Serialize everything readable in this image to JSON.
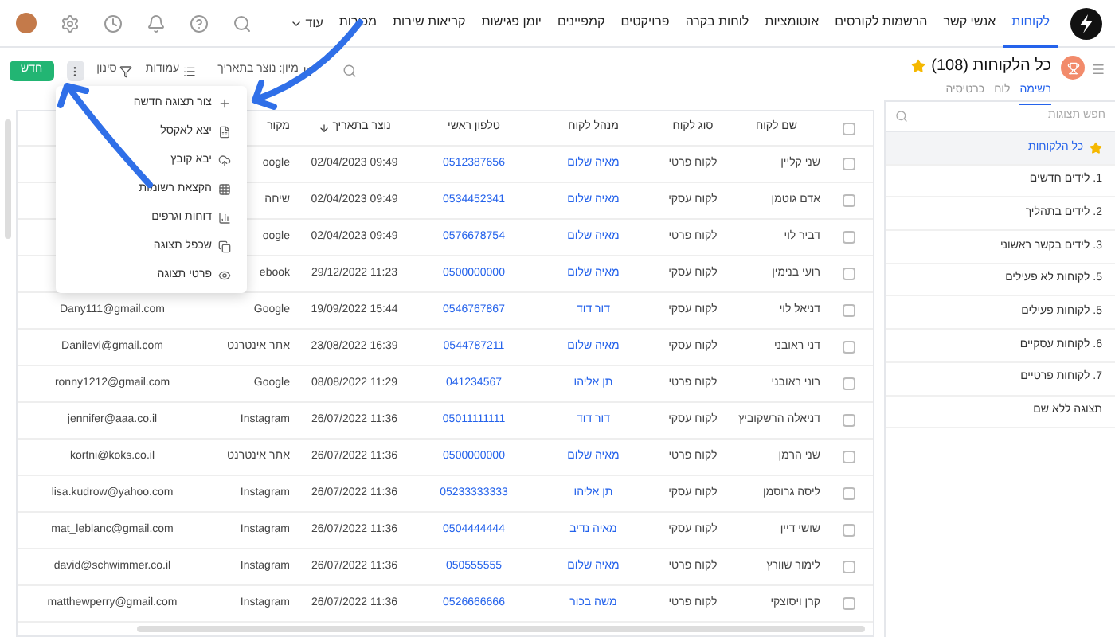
{
  "nav": {
    "items": [
      {
        "label": "לקוחות",
        "selected": true
      },
      {
        "label": "אנשי קשר",
        "selected": false
      },
      {
        "label": "הרשמות לקורסים",
        "selected": false
      },
      {
        "label": "אוטומציות",
        "selected": false
      },
      {
        "label": "לוחות בקרה",
        "selected": false
      },
      {
        "label": "פרויקטים",
        "selected": false
      },
      {
        "label": "קמפיינים",
        "selected": false
      },
      {
        "label": "יומן פגישות",
        "selected": false
      },
      {
        "label": "קריאות שירות",
        "selected": false
      },
      {
        "label": "מכירות",
        "selected": false
      }
    ],
    "more": "עוד"
  },
  "header": {
    "title": "כל הלקוחות (108)",
    "favorite": true,
    "tabs": [
      {
        "label": "רשימה",
        "selected": true
      },
      {
        "label": "לוח",
        "selected": false
      },
      {
        "label": "כרטיסיה",
        "selected": false
      }
    ],
    "toolbar": {
      "sort": "מיון: נוצר בתאריך",
      "columns": "עמודות",
      "filter": "סינון",
      "new": "חדש"
    }
  },
  "sidebar": {
    "placeholder": "חפש תצוגות",
    "items": [
      {
        "label": "כל הלקוחות",
        "selected": true
      },
      {
        "label": "1. לידים חדשים",
        "selected": false
      },
      {
        "label": "2. לידים בתהליך",
        "selected": false
      },
      {
        "label": "3. לידים בקשר ראשוני",
        "selected": false
      },
      {
        "label": "5. לקוחות לא פעילים",
        "selected": false
      },
      {
        "label": "5. לקוחות פעילים",
        "selected": false
      },
      {
        "label": "6. לקוחות עסקיים",
        "selected": false
      },
      {
        "label": "7. לקוחות פרטיים",
        "selected": false
      },
      {
        "label": "תצוגה ללא שם",
        "selected": false
      }
    ]
  },
  "table": {
    "all_checked": false,
    "columns": [
      {
        "label": "שם לקוח",
        "sorted": false
      },
      {
        "label": "סוג לקוח",
        "sorted": false
      },
      {
        "label": "מנהל לקוח",
        "sorted": false
      },
      {
        "label": "טלפון ראשי",
        "sorted": false
      },
      {
        "label": "נוצר בתאריך",
        "sorted": true
      },
      {
        "label": "מקור",
        "sorted": false
      }
    ],
    "rows": [
      {
        "checked": false,
        "cells": [
          "שני קליין",
          "לקוח פרטי",
          "מאיה שלום",
          "0512387656",
          "09:49 02/04/2023",
          "oogle"
        ]
      },
      {
        "checked": false,
        "cells": [
          "אדם גוטמן",
          "לקוח עסקי",
          "מאיה שלום",
          "0534452341",
          "09:49 02/04/2023",
          "שיחה"
        ]
      },
      {
        "checked": false,
        "cells": [
          "דביר לוי",
          "לקוח פרטי",
          "מאיה שלום",
          "0576678754",
          "09:49 02/04/2023",
          "oogle"
        ]
      },
      {
        "checked": false,
        "cells": [
          "רועי בנימין",
          "לקוח עסקי",
          "מאיה שלום",
          "0500000000",
          "11:23 29/12/2022",
          "ebook"
        ]
      },
      {
        "checked": false,
        "cells": [
          "דניאל לוי",
          "לקוח עסקי",
          "דור דוד",
          "0546767867",
          "15:44 19/09/2022",
          "Google",
          "Dany111@gmail.com"
        ]
      },
      {
        "checked": false,
        "cells": [
          "דני ראובני",
          "לקוח עסקי",
          "מאיה שלום",
          "0544787211",
          "16:39 23/08/2022",
          "אתר אינטרנט",
          "Danilevi@gmail.com"
        ]
      },
      {
        "checked": false,
        "cells": [
          "רוני ראובני",
          "לקוח פרטי",
          "תן אליהו",
          "041234567",
          "11:29 08/08/2022",
          "Google",
          "ronny1212@gmail.com"
        ]
      },
      {
        "checked": false,
        "cells": [
          "דניאלה הרשקוביץ",
          "לקוח עסקי",
          "דור דוד",
          "05011111111",
          "11:36 26/07/2022",
          "Instagram",
          "jennifer@aaa.co.il"
        ]
      },
      {
        "checked": false,
        "cells": [
          "שני הרמן",
          "לקוח פרטי",
          "מאיה שלום",
          "0500000000",
          "11:36 26/07/2022",
          "אתר אינטרנט",
          "kortni@koks.co.il"
        ]
      },
      {
        "checked": false,
        "cells": [
          "ליסה גרוסמן",
          "לקוח עסקי",
          "תן אליהו",
          "05233333333",
          "11:36 26/07/2022",
          "Instagram",
          "lisa.kudrow@yahoo.com"
        ]
      },
      {
        "checked": false,
        "cells": [
          "שושי דיין",
          "לקוח עסקי",
          "מאיה נדיב",
          "0504444444",
          "11:36 26/07/2022",
          "Instagram",
          "mat_leblanc@gmail.com"
        ]
      },
      {
        "checked": false,
        "cells": [
          "לימור שוורץ",
          "לקוח פרטי",
          "מאיה שלום",
          "050555555",
          "11:36 26/07/2022",
          "Instagram",
          "david@schwimmer.co.il"
        ]
      },
      {
        "checked": false,
        "cells": [
          "קרן ויסוצקי",
          "לקוח פרטי",
          "משה בכור",
          "0526666666",
          "11:36 26/07/2022",
          "Instagram",
          "matthewperry@gmail.com"
        ]
      }
    ]
  },
  "menu": {
    "items": [
      "צור תצוגה חדשה",
      "יצא לאקסל",
      "יבא קובץ",
      "הקצאת רשומות",
      "דוחות וגרפים",
      "שכפל תצוגה",
      "פרטי תצוגה"
    ]
  }
}
